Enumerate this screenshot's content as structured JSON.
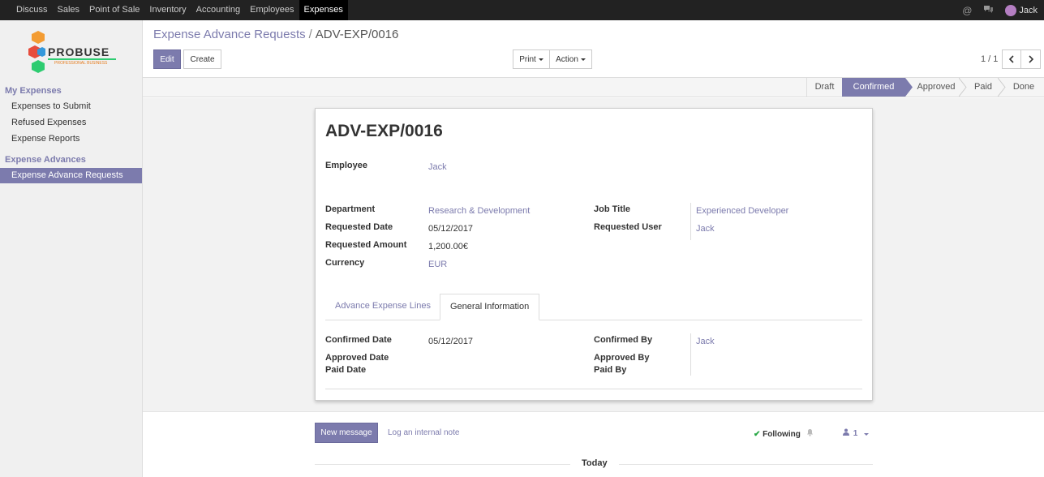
{
  "topbar": {
    "menu": [
      "Discuss",
      "Sales",
      "Point of Sale",
      "Inventory",
      "Accounting",
      "Employees",
      "Expenses"
    ],
    "active_index": 6,
    "user_name": "Jack"
  },
  "logo": {
    "brand": "PROBUSE",
    "tagline": "PROFESSIONAL BUSINESS"
  },
  "sidebar": {
    "sections": [
      {
        "title": "My Expenses",
        "items": [
          "Expenses to Submit",
          "Refused Expenses",
          "Expense Reports"
        ]
      },
      {
        "title": "Expense Advances",
        "items": [
          "Expense Advance Requests"
        ]
      }
    ]
  },
  "breadcrumb": {
    "parent": "Expense Advance Requests",
    "separator": "/",
    "current": "ADV-EXP/0016"
  },
  "buttons": {
    "edit": "Edit",
    "create": "Create",
    "print": "Print",
    "action": "Action"
  },
  "pager": {
    "text": "1 / 1"
  },
  "statusbar": {
    "stages": [
      "Draft",
      "Confirmed",
      "Approved",
      "Paid",
      "Done"
    ],
    "active": "Confirmed"
  },
  "form": {
    "title": "ADV-EXP/0016",
    "employee_label": "Employee",
    "employee": "Jack",
    "department_label": "Department",
    "department": "Research & Development",
    "requested_date_label": "Requested Date",
    "requested_date": "05/12/2017",
    "requested_amount_label": "Requested Amount",
    "requested_amount": "1,200.00€",
    "currency_label": "Currency",
    "currency": "EUR",
    "job_title_label": "Job Title",
    "job_title": "Experienced Developer",
    "requested_user_label": "Requested User",
    "requested_user": "Jack",
    "tabs": [
      "Advance Expense Lines",
      "General Information"
    ],
    "active_tab": "General Information",
    "confirmed_date_label": "Confirmed Date",
    "confirmed_date": "05/12/2017",
    "approved_date_label": "Approved Date",
    "approved_date": "",
    "paid_date_label": "Paid Date",
    "paid_date": "",
    "confirmed_by_label": "Confirmed By",
    "confirmed_by": "Jack",
    "approved_by_label": "Approved By",
    "approved_by": "",
    "paid_by_label": "Paid By",
    "paid_by": ""
  },
  "chatter": {
    "new_message": "New message",
    "log_note": "Log an internal note",
    "following": "Following",
    "followers_count": "1",
    "today": "Today"
  },
  "colors": {
    "accent": "#7c7bad",
    "topbar": "#222222"
  }
}
